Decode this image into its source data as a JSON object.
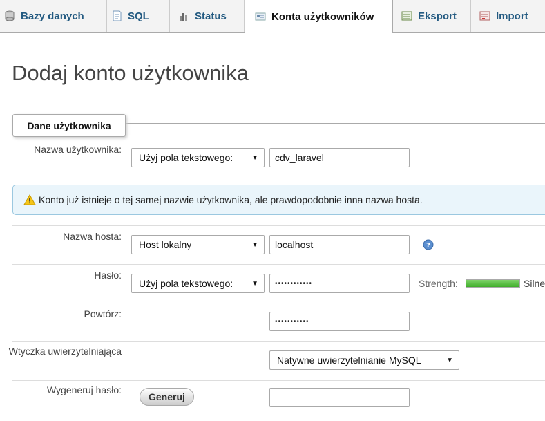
{
  "tabs": [
    {
      "label": "Bazy danych",
      "icon": "database-icon"
    },
    {
      "label": "SQL",
      "icon": "sql-icon"
    },
    {
      "label": "Status",
      "icon": "status-icon"
    },
    {
      "label": "Konta użytkowników",
      "icon": "users-icon"
    },
    {
      "label": "Eksport",
      "icon": "export-icon"
    },
    {
      "label": "Import",
      "icon": "import-icon"
    }
  ],
  "page_title": "Dodaj konto użytkownika",
  "fieldset_legend": "Dane użytkownika",
  "form": {
    "username": {
      "label": "Nazwa użytkownika:",
      "mode": "Użyj pola tekstowego:",
      "value": "cdv_laravel"
    },
    "warning": "Konto już istnieje o tej samej nazwie użytkownika, ale prawdopodobnie inna nazwa hosta.",
    "host": {
      "label": "Nazwa hosta:",
      "mode": "Host lokalny",
      "value": "localhost"
    },
    "password": {
      "label": "Hasło:",
      "mode": "Użyj pola tekstowego:",
      "value": "••••••••••••",
      "strength_label": "Strength:",
      "strength_value": "Silne",
      "strength_level": 1.0
    },
    "retype": {
      "label": "Powtórz:",
      "value": "•••••••••••"
    },
    "auth_plugin": {
      "label": "Wtyczka uwierzytelniająca",
      "value": "Natywne uwierzytelnianie MySQL"
    },
    "generate": {
      "label": "Wygeneruj hasło:",
      "button": "Generuj",
      "value": ""
    }
  },
  "colors": {
    "link": "#235a81",
    "warning_bg": "#eaf5fb",
    "meter": "#3fae2a"
  }
}
